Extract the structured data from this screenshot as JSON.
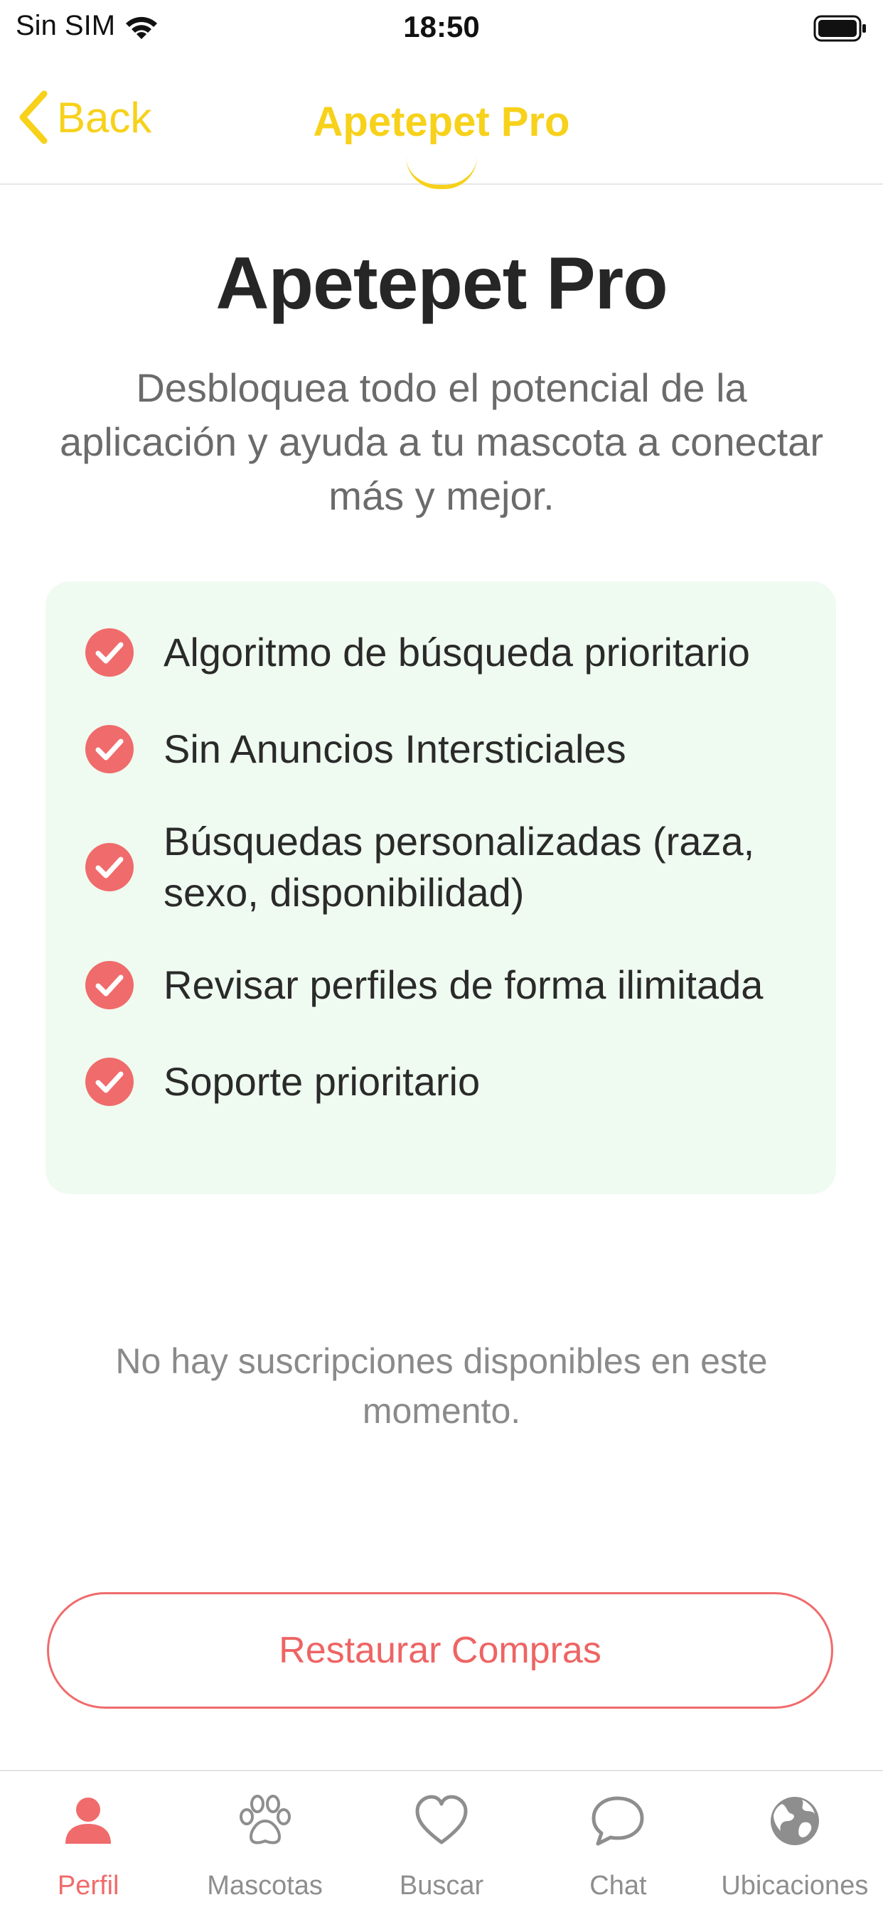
{
  "status_bar": {
    "carrier": "Sin SIM",
    "time": "18:50"
  },
  "nav": {
    "back_label": "Back",
    "title": "Apetepet Pro"
  },
  "main": {
    "title": "Apetepet Pro",
    "subtitle": "Desbloquea todo el potencial de la aplicación y ayuda a tu mascota a conectar más y mejor."
  },
  "features": [
    {
      "label": "Algoritmo de búsqueda prioritario"
    },
    {
      "label": "Sin Anuncios Intersticiales"
    },
    {
      "label": "Búsquedas personalizadas (raza, sexo, disponibilidad)"
    },
    {
      "label": "Revisar perfiles de forma ilimitada"
    },
    {
      "label": "Soporte prioritario"
    }
  ],
  "no_subscriptions": "No hay suscripciones disponibles en este momento.",
  "restore_button_label": "Restaurar Compras",
  "tabs": [
    {
      "label": "Perfil",
      "icon": "person-icon",
      "active": true
    },
    {
      "label": "Mascotas",
      "icon": "paw-icon",
      "active": false
    },
    {
      "label": "Buscar",
      "icon": "heart-icon",
      "active": false
    },
    {
      "label": "Chat",
      "icon": "chat-bubble-icon",
      "active": false
    },
    {
      "label": "Ubicaciones",
      "icon": "globe-icon",
      "active": false
    }
  ],
  "colors": {
    "accent_yellow": "#f7d11a",
    "accent_red": "#f06b6b",
    "card_background": "#effbf0"
  }
}
